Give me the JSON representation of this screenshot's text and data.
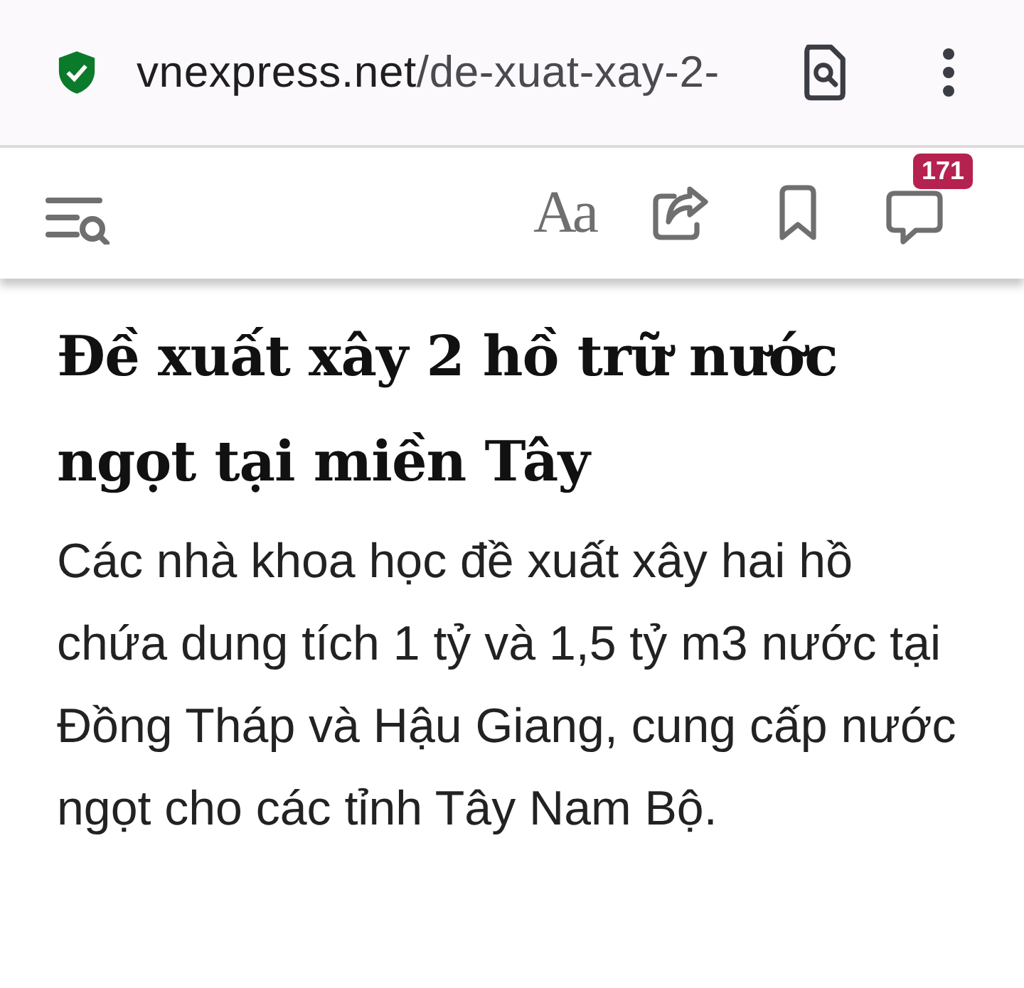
{
  "address_bar": {
    "secure": true,
    "domain": "vnexpress.net",
    "path": "/de-xuat-xay-2-"
  },
  "toolbar": {
    "font_button": "Aa",
    "comment_count": "171"
  },
  "article": {
    "title": "Đề xuất xây 2 hồ trữ nước ngọt tại miền Tây",
    "summary": "Các nhà khoa học đề xuất xây hai hồ chứa dung tích 1 tỷ và 1,5 tỷ m3 nước tại Đồng Tháp và Hậu Giang, cung cấp nước ngọt cho các tỉnh Tây Nam Bộ."
  }
}
